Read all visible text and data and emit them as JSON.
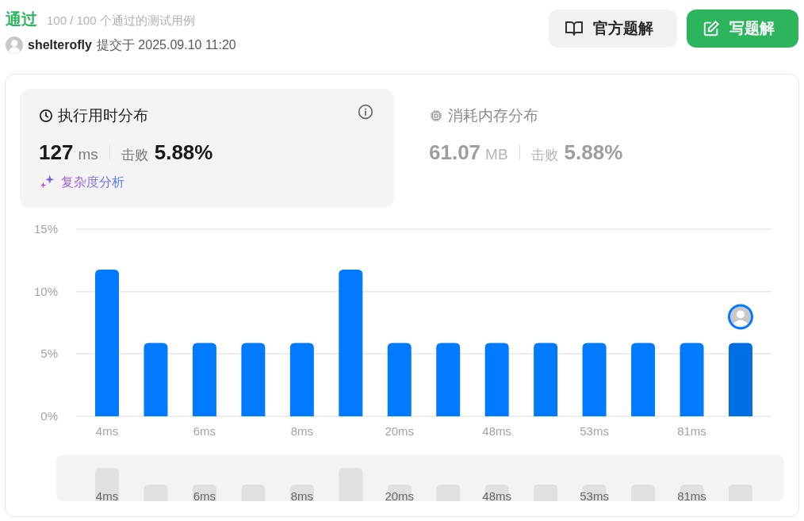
{
  "header": {
    "status": "通过",
    "cases": "100 / 100 个通过的测试用例",
    "user": "shelterofly",
    "submitted": "提交于 2025.09.10 11:20"
  },
  "buttons": [
    {
      "kind": "outline",
      "label": "官方题解"
    },
    {
      "kind": "primary",
      "label": "写题解"
    }
  ],
  "stats": [
    {
      "kind": "time",
      "selected": true,
      "title": "执行用时分布",
      "value": "127",
      "unit": "ms",
      "beat_label": "击败",
      "beat": "5.88%",
      "link": "复杂度分析"
    },
    {
      "kind": "memory",
      "selected": false,
      "title": "消耗内存分布",
      "value": "61.07",
      "unit": "MB",
      "beat_label": "击败",
      "beat": "5.88%"
    }
  ],
  "chart": {
    "bars": [
      {
        "selected": false
      },
      {
        "selected": false
      },
      {
        "selected": false
      },
      {
        "selected": false
      },
      {
        "selected": false
      },
      {
        "selected": false
      },
      {
        "selected": false
      },
      {
        "selected": false
      },
      {
        "selected": false
      },
      {
        "selected": false
      },
      {
        "selected": false
      },
      {
        "selected": false
      },
      {
        "selected": false
      },
      {
        "selected": true
      }
    ],
    "chart_data": {
      "type": "bar",
      "categories": [
        "4ms",
        null,
        "6ms",
        null,
        "8ms",
        null,
        "20ms",
        null,
        "48ms",
        null,
        "53ms",
        null,
        "81ms",
        null
      ],
      "values": [
        11.76,
        5.88,
        5.88,
        5.88,
        5.88,
        11.76,
        5.88,
        5.88,
        5.88,
        5.88,
        5.88,
        5.88,
        5.88,
        5.88
      ],
      "ylim": [
        0,
        15
      ],
      "yticks": [
        {
          "value": 0,
          "label": "0%"
        },
        {
          "value": 5,
          "label": "5%"
        },
        {
          "value": 10,
          "label": "10%"
        },
        {
          "value": 15,
          "label": "15%"
        }
      ]
    }
  },
  "overview": {
    "labels": [
      "4ms",
      "6ms",
      "8ms",
      "20ms",
      "48ms",
      "53ms",
      "81ms"
    ]
  }
}
